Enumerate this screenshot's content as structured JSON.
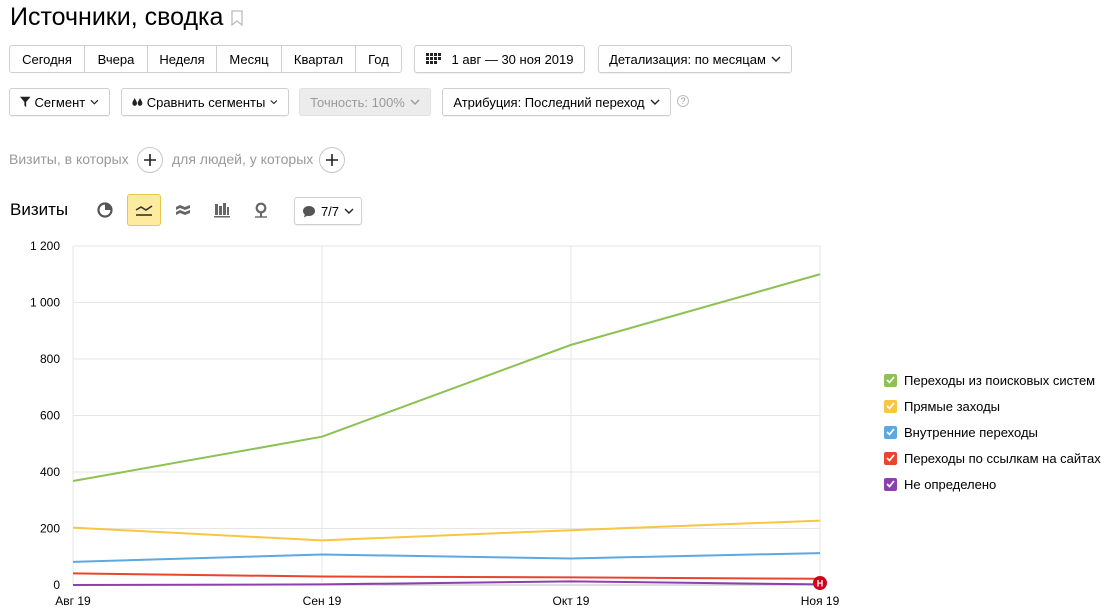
{
  "header": {
    "title": "Источники, сводка"
  },
  "period_buttons": [
    "Сегодня",
    "Вчера",
    "Неделя",
    "Месяц",
    "Квартал",
    "Год"
  ],
  "date_range": {
    "label": "1 авг — 30 ноя 2019"
  },
  "detail": {
    "label": "Детализация: по месяцам"
  },
  "filters": {
    "segment": "Сегмент",
    "compare": "Сравнить сегменты",
    "accuracy": "Точность: 100%",
    "attribution": "Атрибуция: Последний переход",
    "help": "?"
  },
  "conditions": {
    "visits": "Визиты, в которых",
    "people": "для людей, у которых"
  },
  "chart_header": {
    "title": "Визиты",
    "notes": "7/7"
  },
  "colors": {
    "green": "#8dc153",
    "yellow": "#f8c642",
    "blue": "#5ca8e0",
    "red": "#e8452f",
    "purple": "#8e3fae"
  },
  "chart_data": {
    "type": "line",
    "categories": [
      "Авг 19",
      "Сен 19",
      "Окт 19",
      "Ноя 19"
    ],
    "ylim": [
      0,
      1200
    ],
    "yticks": [
      "0",
      "200",
      "400",
      "600",
      "800",
      "1 000",
      "1 200"
    ],
    "grid": true,
    "legend_position": "right",
    "series": [
      {
        "name": "Переходы из поисковых систем",
        "color": "#8dc153",
        "values": [
          368,
          525,
          850,
          1100
        ]
      },
      {
        "name": "Прямые заходы",
        "color": "#f8c642",
        "values": [
          203,
          158,
          194,
          228
        ]
      },
      {
        "name": "Внутренние переходы",
        "color": "#5ca8e0",
        "values": [
          82,
          108,
          94,
          113
        ]
      },
      {
        "name": "Переходы по ссылкам на сайтах",
        "color": "#e8452f",
        "values": [
          41,
          30,
          27,
          22
        ]
      },
      {
        "name": "Не определено",
        "color": "#8e3fae",
        "values": [
          0,
          2,
          13,
          2
        ]
      }
    ],
    "annotation": {
      "label": "Н",
      "category": "Ноя 19"
    }
  }
}
